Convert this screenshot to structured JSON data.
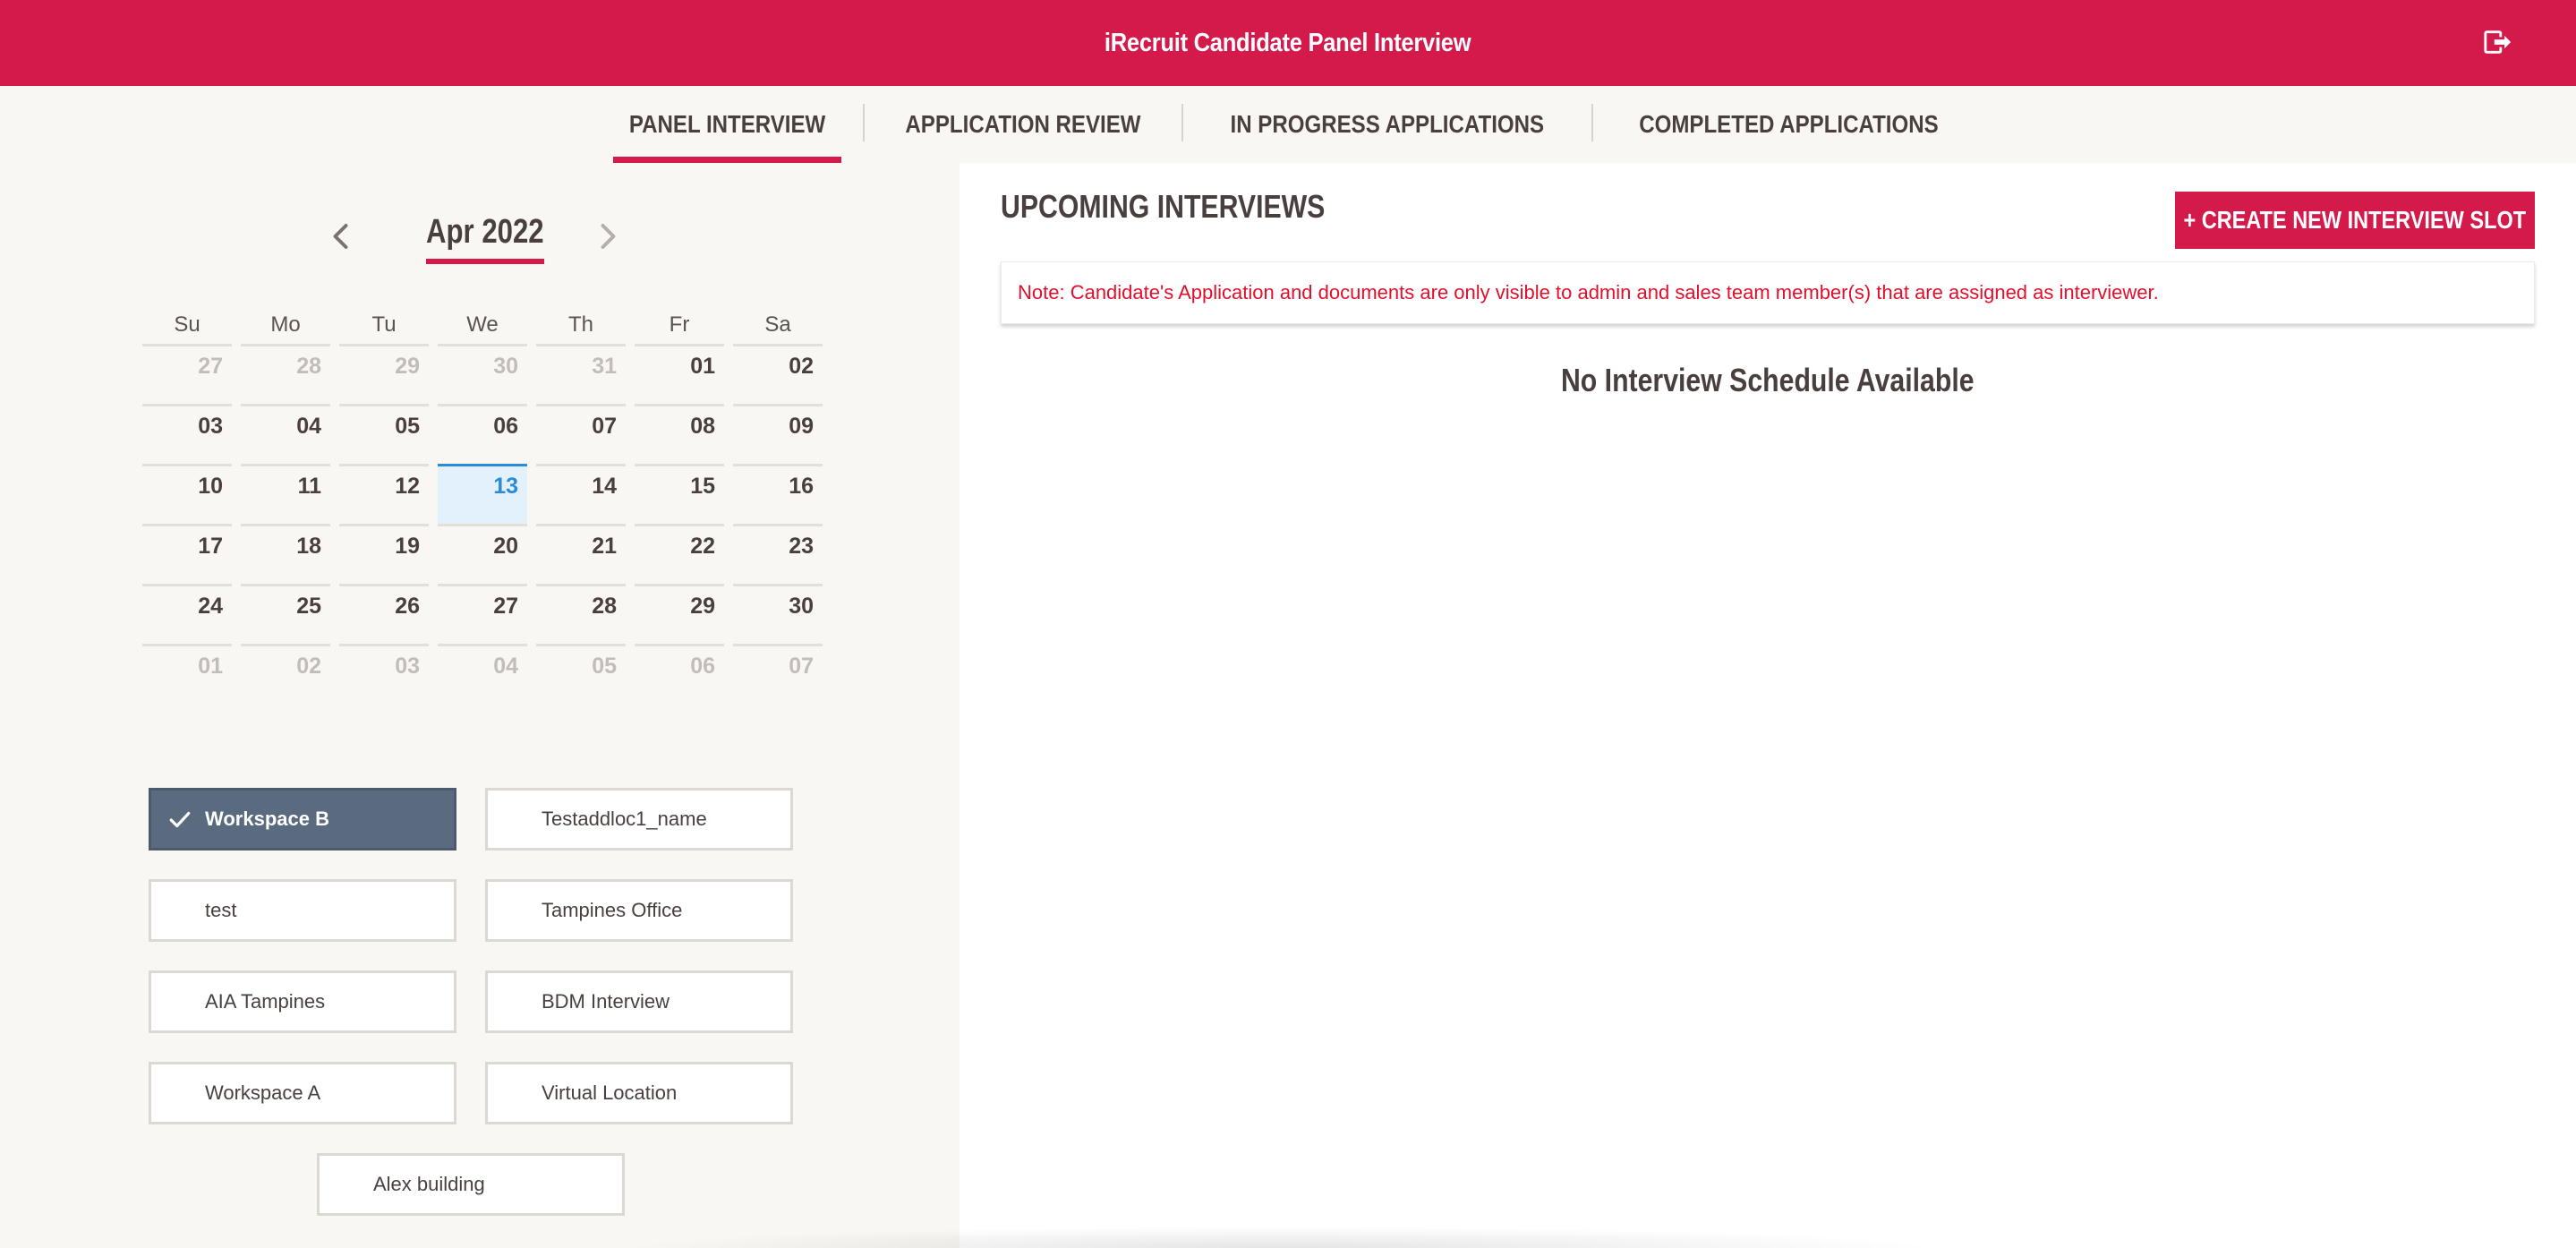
{
  "header": {
    "title": "iRecruit Candidate Panel Interview",
    "logout_icon": "logout-icon"
  },
  "tabs": [
    {
      "label": "PANEL INTERVIEW",
      "active": true
    },
    {
      "label": "APPLICATION REVIEW",
      "active": false
    },
    {
      "label": "IN PROGRESS APPLICATIONS",
      "active": false
    },
    {
      "label": "COMPLETED APPLICATIONS",
      "active": false
    }
  ],
  "calendar": {
    "month_label": "Apr 2022",
    "prev_icon": "chevron-left-icon",
    "next_icon": "chevron-right-icon",
    "weekdays": [
      "Su",
      "Mo",
      "Tu",
      "We",
      "Th",
      "Fr",
      "Sa"
    ],
    "weeks": [
      [
        {
          "d": "27",
          "m": true
        },
        {
          "d": "28",
          "m": true
        },
        {
          "d": "29",
          "m": true
        },
        {
          "d": "30",
          "m": true
        },
        {
          "d": "31",
          "m": true
        },
        {
          "d": "01",
          "m": false
        },
        {
          "d": "02",
          "m": false
        }
      ],
      [
        {
          "d": "03",
          "m": false
        },
        {
          "d": "04",
          "m": false
        },
        {
          "d": "05",
          "m": false
        },
        {
          "d": "06",
          "m": false
        },
        {
          "d": "07",
          "m": false
        },
        {
          "d": "08",
          "m": false
        },
        {
          "d": "09",
          "m": false
        }
      ],
      [
        {
          "d": "10",
          "m": false
        },
        {
          "d": "11",
          "m": false
        },
        {
          "d": "12",
          "m": false
        },
        {
          "d": "13",
          "m": false,
          "today": true
        },
        {
          "d": "14",
          "m": false
        },
        {
          "d": "15",
          "m": false
        },
        {
          "d": "16",
          "m": false
        }
      ],
      [
        {
          "d": "17",
          "m": false
        },
        {
          "d": "18",
          "m": false
        },
        {
          "d": "19",
          "m": false
        },
        {
          "d": "20",
          "m": false
        },
        {
          "d": "21",
          "m": false
        },
        {
          "d": "22",
          "m": false
        },
        {
          "d": "23",
          "m": false
        }
      ],
      [
        {
          "d": "24",
          "m": false
        },
        {
          "d": "25",
          "m": false
        },
        {
          "d": "26",
          "m": false
        },
        {
          "d": "27",
          "m": false
        },
        {
          "d": "28",
          "m": false
        },
        {
          "d": "29",
          "m": false
        },
        {
          "d": "30",
          "m": false
        }
      ],
      [
        {
          "d": "01",
          "m": true
        },
        {
          "d": "02",
          "m": true
        },
        {
          "d": "03",
          "m": true
        },
        {
          "d": "04",
          "m": true
        },
        {
          "d": "05",
          "m": true
        },
        {
          "d": "06",
          "m": true
        },
        {
          "d": "07",
          "m": true
        }
      ]
    ]
  },
  "locations": [
    {
      "label": "Workspace B",
      "selected": true
    },
    {
      "label": "Testaddloc1_name",
      "selected": false
    },
    {
      "label": "test",
      "selected": false
    },
    {
      "label": "Tampines Office",
      "selected": false
    },
    {
      "label": "AIA Tampines",
      "selected": false
    },
    {
      "label": "BDM Interview",
      "selected": false
    },
    {
      "label": "Workspace A",
      "selected": false
    },
    {
      "label": "Virtual Location",
      "selected": false
    },
    {
      "label": "Alex building",
      "selected": false
    }
  ],
  "main": {
    "title": "UPCOMING INTERVIEWS",
    "create_button": "+ CREATE NEW INTERVIEW SLOT",
    "note": "Note: Candidate's Application and documents are only visible to admin and sales team member(s) that are assigned as interviewer.",
    "empty_message": "No Interview Schedule Available"
  },
  "colors": {
    "brand": "#d4194b",
    "selected_location": "#5a6b80",
    "today_highlight": "#2a8bd9",
    "note_text": "#e0102c"
  }
}
